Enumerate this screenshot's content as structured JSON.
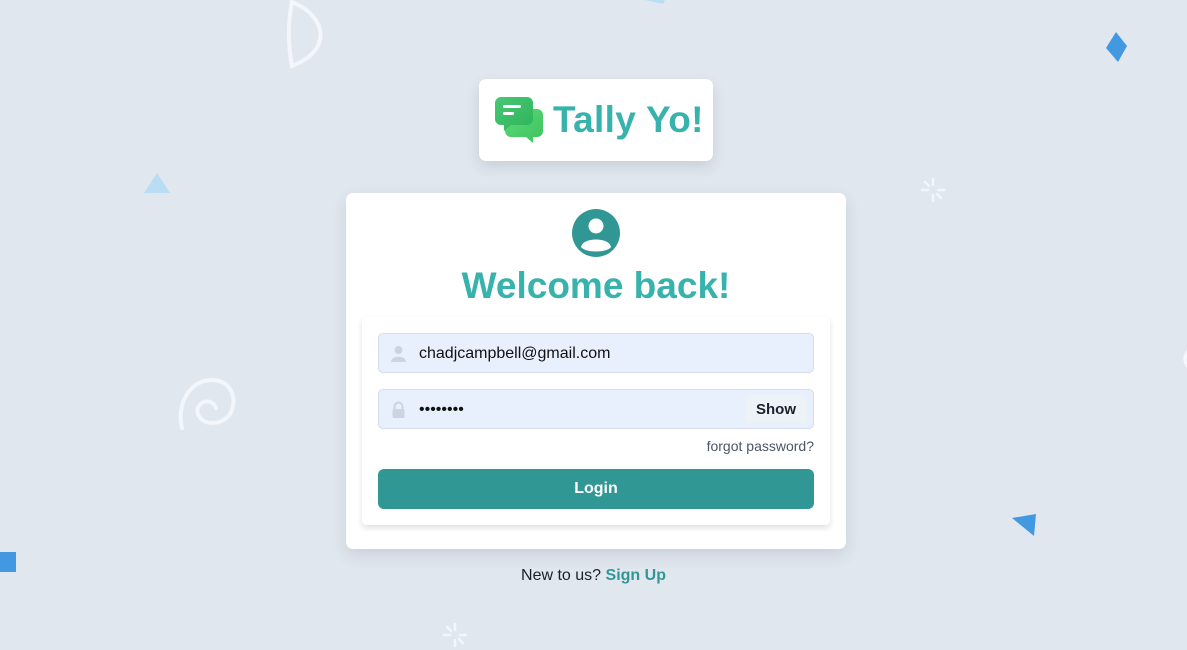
{
  "brand": {
    "name": "Tally Yo!",
    "logo_icon": "chat-bubbles-icon",
    "color": "#38b2ac"
  },
  "card": {
    "avatar_icon": "user-circle-icon",
    "heading": "Welcome back!"
  },
  "form": {
    "email": {
      "icon": "user-icon",
      "value": "chadjcampbell@gmail.com"
    },
    "password": {
      "icon": "lock-icon",
      "value": "••••••••",
      "toggle_label": "Show"
    },
    "forgot_label": "forgot password?",
    "submit_label": "Login"
  },
  "footer": {
    "prompt": "New to us?",
    "signup_label": "Sign Up"
  },
  "colors": {
    "background": "#e1e7ef",
    "accent": "#38b2ac",
    "button": "#319795",
    "input_bg": "#e8f0fe"
  }
}
